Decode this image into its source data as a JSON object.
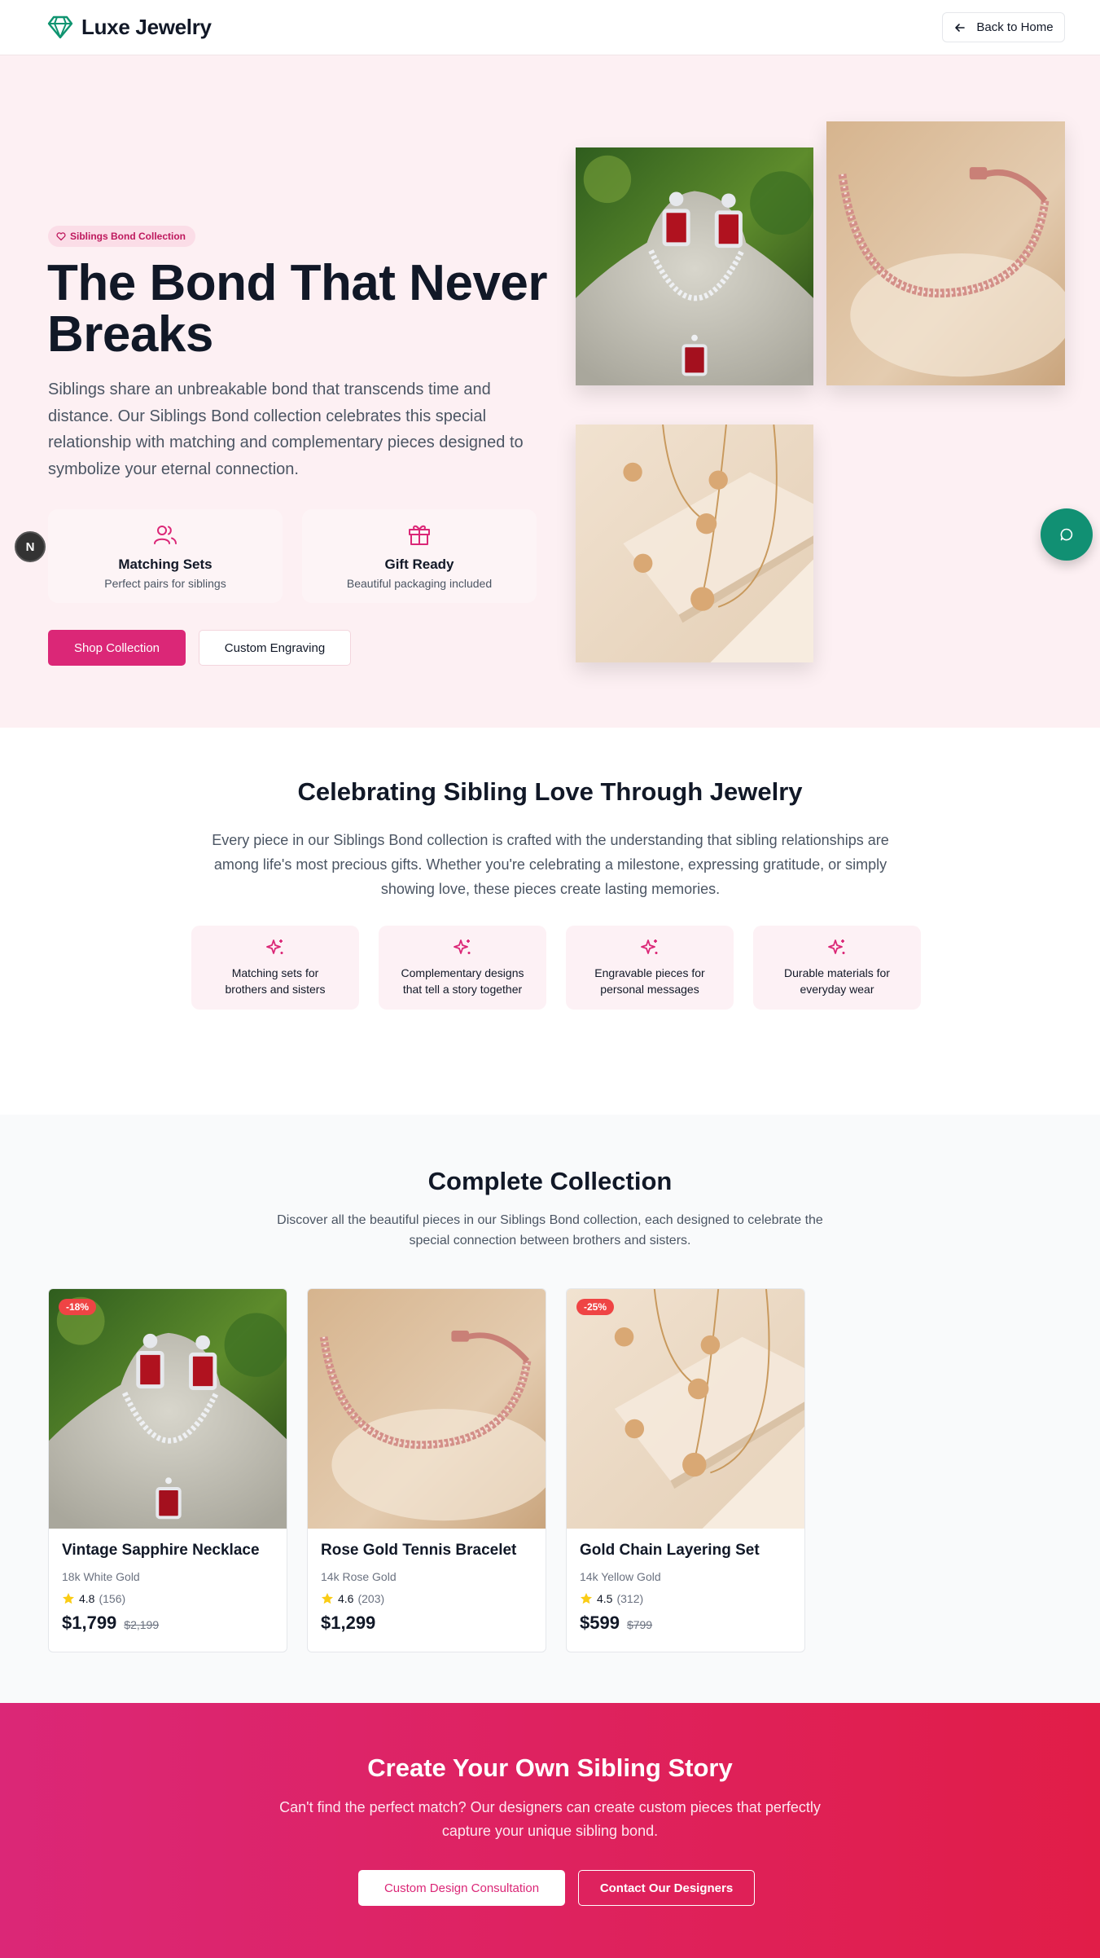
{
  "header": {
    "brand": "Luxe Jewelry",
    "back_label": "Back to Home",
    "logo_icon": "gem-icon",
    "brand_color": "#0f9470"
  },
  "hero": {
    "badge": "Siblings Bond Collection",
    "title": "The Bond That Never Breaks",
    "description": "Siblings share an unbreakable bond that transcends time and distance. Our Siblings Bond collection celebrates this special relationship with matching and complementary pieces designed to symbolize your eternal connection.",
    "features": [
      {
        "icon": "users-icon",
        "title": "Matching Sets",
        "subtitle": "Perfect pairs for siblings"
      },
      {
        "icon": "gift-icon",
        "title": "Gift Ready",
        "subtitle": "Beautiful packaging included"
      }
    ],
    "primary_cta": "Shop Collection",
    "secondary_cta": "Custom Engraving",
    "accent_color": "#db2777"
  },
  "floating": {
    "left_badge": "N",
    "chat_icon": "chat-icon",
    "chat_color": "#119073"
  },
  "about": {
    "title": "Celebrating Sibling Love Through Jewelry",
    "description": "Every piece in our Siblings Bond collection is crafted with the understanding that sibling relationships are among life's most precious gifts. Whether you're celebrating a milestone, expressing gratitude, or simply showing love, these pieces create lasting memories.",
    "values": [
      {
        "icon": "sparkles-icon",
        "line1": "Matching sets for",
        "line2": "brothers and sisters"
      },
      {
        "icon": "sparkles-icon",
        "line1": "Complementary designs",
        "line2": "that tell a story together"
      },
      {
        "icon": "sparkles-icon",
        "line1": "Engravable pieces for",
        "line2": "personal messages"
      },
      {
        "icon": "sparkles-icon",
        "line1": "Durable materials for",
        "line2": "everyday wear"
      }
    ]
  },
  "collection": {
    "title": "Complete Collection",
    "description": "Discover all the beautiful pieces in our Siblings Bond collection, each designed to celebrate the special connection between brothers and sisters.",
    "products": [
      {
        "name": "Vintage Sapphire Necklace",
        "material": "18k White Gold",
        "rating": "4.8",
        "reviews": "(156)",
        "price": "$1,799",
        "old_price": "$2,199",
        "discount": "-18%"
      },
      {
        "name": "Rose Gold Tennis Bracelet",
        "material": "14k Rose Gold",
        "rating": "4.6",
        "reviews": "(203)",
        "price": "$1,299",
        "old_price": "",
        "discount": ""
      },
      {
        "name": "Gold Chain Layering Set",
        "material": "14k Yellow Gold",
        "rating": "4.5",
        "reviews": "(312)",
        "price": "$599",
        "old_price": "$799",
        "discount": "-25%"
      }
    ]
  },
  "cta": {
    "title": "Create Your Own Sibling Story",
    "description": "Can't find the perfect match? Our designers can create custom pieces that perfectly capture your unique sibling bond.",
    "button_primary": "Custom Design Consultation",
    "button_secondary": "Contact Our Designers"
  }
}
